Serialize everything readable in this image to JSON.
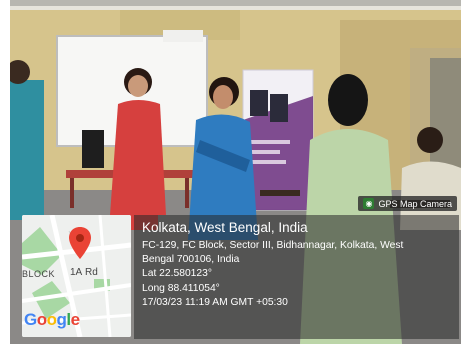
{
  "photo": {
    "description_icon": "camera-icon",
    "colors": {
      "wall": "#d9c78e",
      "floor": "#8e8c8a",
      "ceiling": "#e8e6df"
    }
  },
  "banner": {
    "headline": "GPS Map Camera",
    "icon": "camera-icon"
  },
  "location": {
    "title": "Kolkata, West Bengal, India",
    "address_line1": "FC-129, FC Block, Sector III, Bidhannagar, Kolkata, West",
    "address_line2": "Bengal 700106, India",
    "latitude": "Lat 22.580123°",
    "longitude": "Long 88.411054°",
    "timestamp": "17/03/23 11:19 AM GMT +05:30"
  },
  "map": {
    "road_label": "Rd",
    "road_number": "1A",
    "block_label": "BLOCK",
    "logo_letters": [
      "G",
      "o",
      "o",
      "g",
      "l",
      "e"
    ],
    "logo_colors": [
      "#4285F4",
      "#EA4335",
      "#FBBC05",
      "#4285F4",
      "#34A853",
      "#EA4335"
    ],
    "pin_icon": "map-pin-icon"
  }
}
